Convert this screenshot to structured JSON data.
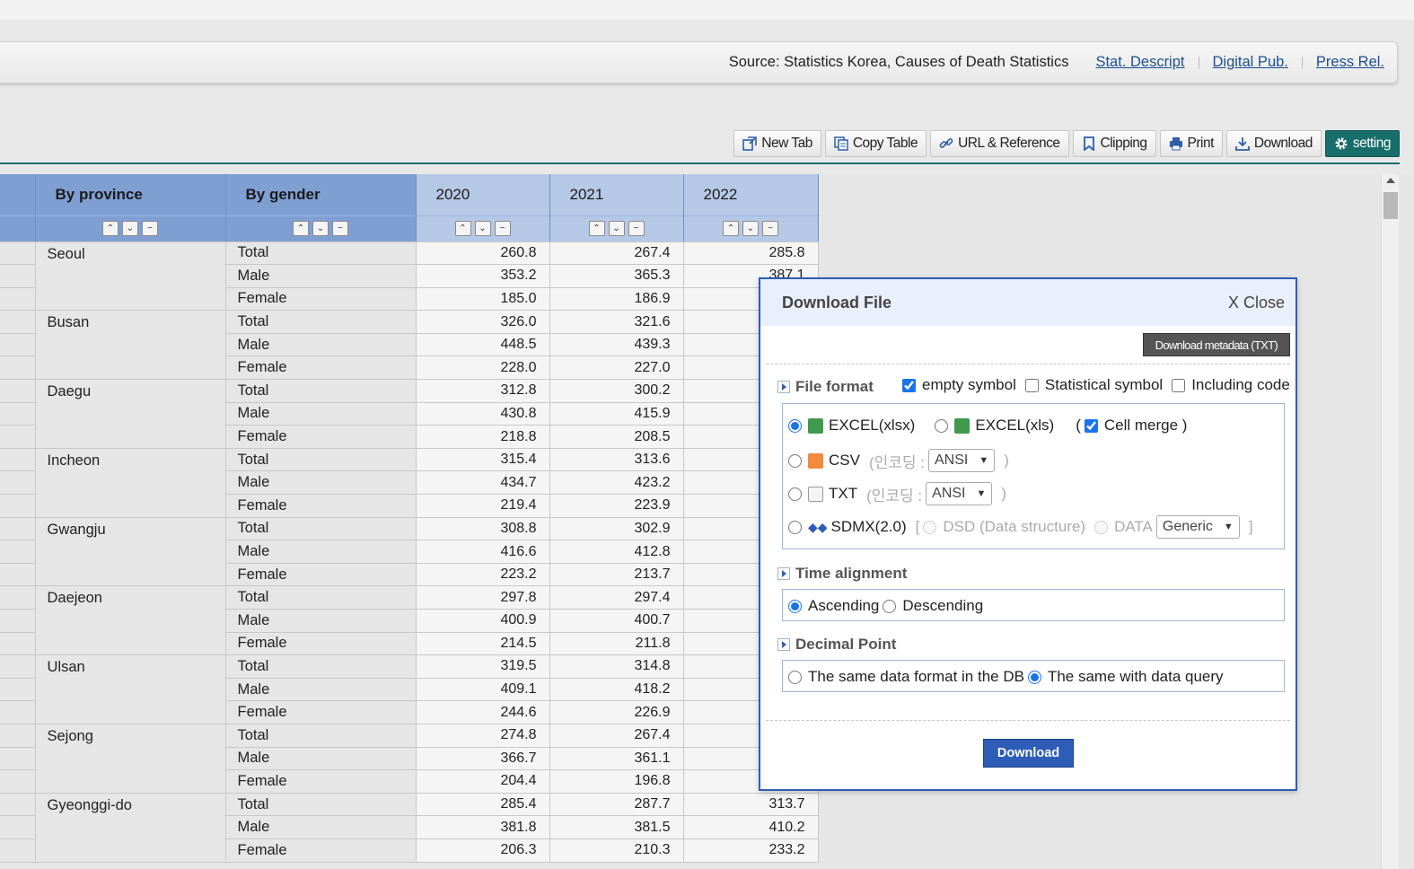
{
  "source_bar": {
    "source_text": "Source: Statistics Korea, Causes of Death Statistics",
    "links": [
      "Stat. Descript",
      "Digital Pub.",
      "Press Rel."
    ]
  },
  "toolbar": {
    "new_tab": "New Tab",
    "copy_table": "Copy Table",
    "url_reference": "URL & Reference",
    "clipping": "Clipping",
    "print": "Print",
    "download": "Download",
    "setting": "setting"
  },
  "table": {
    "headers": {
      "province": "By province",
      "gender": "By gender",
      "years": [
        "2020",
        "2021",
        "2022"
      ]
    },
    "rows": [
      {
        "province": "Seoul",
        "gender": "Total",
        "values": [
          "260.8",
          "267.4",
          "285.8"
        ]
      },
      {
        "province": "",
        "gender": "Male",
        "values": [
          "353.2",
          "365.3",
          "387.1"
        ]
      },
      {
        "province": "",
        "gender": "Female",
        "values": [
          "185.0",
          "186.9",
          ""
        ]
      },
      {
        "province": "Busan",
        "gender": "Total",
        "values": [
          "326.0",
          "321.6",
          ""
        ]
      },
      {
        "province": "",
        "gender": "Male",
        "values": [
          "448.5",
          "439.3",
          ""
        ]
      },
      {
        "province": "",
        "gender": "Female",
        "values": [
          "228.0",
          "227.0",
          ""
        ]
      },
      {
        "province": "Daegu",
        "gender": "Total",
        "values": [
          "312.8",
          "300.2",
          ""
        ]
      },
      {
        "province": "",
        "gender": "Male",
        "values": [
          "430.8",
          "415.9",
          ""
        ]
      },
      {
        "province": "",
        "gender": "Female",
        "values": [
          "218.8",
          "208.5",
          ""
        ]
      },
      {
        "province": "Incheon",
        "gender": "Total",
        "values": [
          "315.4",
          "313.6",
          ""
        ]
      },
      {
        "province": "",
        "gender": "Male",
        "values": [
          "434.7",
          "423.2",
          ""
        ]
      },
      {
        "province": "",
        "gender": "Female",
        "values": [
          "219.4",
          "223.9",
          ""
        ]
      },
      {
        "province": "Gwangju",
        "gender": "Total",
        "values": [
          "308.8",
          "302.9",
          ""
        ]
      },
      {
        "province": "",
        "gender": "Male",
        "values": [
          "416.6",
          "412.8",
          ""
        ]
      },
      {
        "province": "",
        "gender": "Female",
        "values": [
          "223.2",
          "213.7",
          ""
        ]
      },
      {
        "province": "Daejeon",
        "gender": "Total",
        "values": [
          "297.8",
          "297.4",
          ""
        ]
      },
      {
        "province": "",
        "gender": "Male",
        "values": [
          "400.9",
          "400.7",
          ""
        ]
      },
      {
        "province": "",
        "gender": "Female",
        "values": [
          "214.5",
          "211.8",
          ""
        ]
      },
      {
        "province": "Ulsan",
        "gender": "Total",
        "values": [
          "319.5",
          "314.8",
          ""
        ]
      },
      {
        "province": "",
        "gender": "Male",
        "values": [
          "409.1",
          "418.2",
          ""
        ]
      },
      {
        "province": "",
        "gender": "Female",
        "values": [
          "244.6",
          "226.9",
          ""
        ]
      },
      {
        "province": "Sejong",
        "gender": "Total",
        "values": [
          "274.8",
          "267.4",
          ""
        ]
      },
      {
        "province": "",
        "gender": "Male",
        "values": [
          "366.7",
          "361.1",
          ""
        ]
      },
      {
        "province": "",
        "gender": "Female",
        "values": [
          "204.4",
          "196.8",
          ""
        ]
      },
      {
        "province": "Gyeonggi-do",
        "gender": "Total",
        "values": [
          "285.4",
          "287.7",
          "313.7"
        ]
      },
      {
        "province": "",
        "gender": "Male",
        "values": [
          "381.8",
          "381.5",
          "410.2"
        ]
      },
      {
        "province": "",
        "gender": "Female",
        "values": [
          "206.3",
          "210.3",
          "233.2"
        ]
      }
    ]
  },
  "dialog": {
    "title": "Download File",
    "close": "X Close",
    "metadata_button": "Download metadata (TXT)",
    "file_format": {
      "title": "File format",
      "empty_symbol": "empty symbol",
      "statistical_symbol": "Statistical symbol",
      "including_code": "Including code",
      "excel_xlsx": "EXCEL(xlsx)",
      "excel_xls": "EXCEL(xls)",
      "cell_merge_open": "(",
      "cell_merge": "Cell merge )",
      "csv": "CSV",
      "txt": "TXT",
      "encoding_label": "(인코딩 :",
      "encoding_value": "ANSI",
      "close_paren": ")",
      "sdmx": "SDMX(2.0)",
      "bracket_open": "[",
      "dsd": "DSD (Data structure)",
      "data": "DATA",
      "generic": "Generic",
      "bracket_close": "]"
    },
    "time_alignment": {
      "title": "Time alignment",
      "ascending": "Ascending",
      "descending": "Descending"
    },
    "decimal_point": {
      "title": "Decimal Point",
      "same_db": "The same data format in the DB",
      "same_query": "The same with data query"
    },
    "download_button": "Download"
  },
  "colors": {
    "teal": "#176e6a",
    "header_blue": "#7f9fd3",
    "dialog_blue": "#2d5db6"
  }
}
